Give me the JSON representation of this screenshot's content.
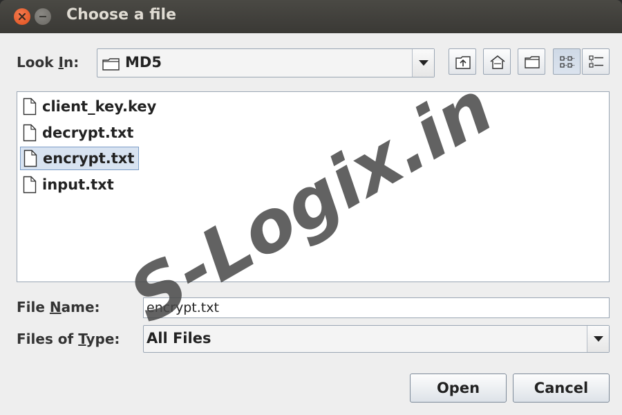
{
  "window": {
    "title": "Choose a file"
  },
  "look_in": {
    "label_pre": "Look ",
    "label_mnemonic": "I",
    "label_post": "n:",
    "value": "MD5"
  },
  "toolbar": {
    "icons": [
      "up-one-level-icon",
      "home-icon",
      "new-folder-icon",
      "list-view-icon",
      "details-view-icon"
    ]
  },
  "files": [
    {
      "name": "client_key.key",
      "selected": false
    },
    {
      "name": "decrypt.txt",
      "selected": false
    },
    {
      "name": "encrypt.txt",
      "selected": true
    },
    {
      "name": "input.txt",
      "selected": false
    }
  ],
  "file_name": {
    "label_pre": "File ",
    "label_mnemonic": "N",
    "label_post": "ame:",
    "value": "encrypt.txt"
  },
  "files_of_type": {
    "label_pre": "Files of ",
    "label_mnemonic": "T",
    "label_post": "ype:",
    "value": "All Files"
  },
  "buttons": {
    "open": "Open",
    "cancel": "Cancel"
  },
  "watermark": "S-Logix.in"
}
